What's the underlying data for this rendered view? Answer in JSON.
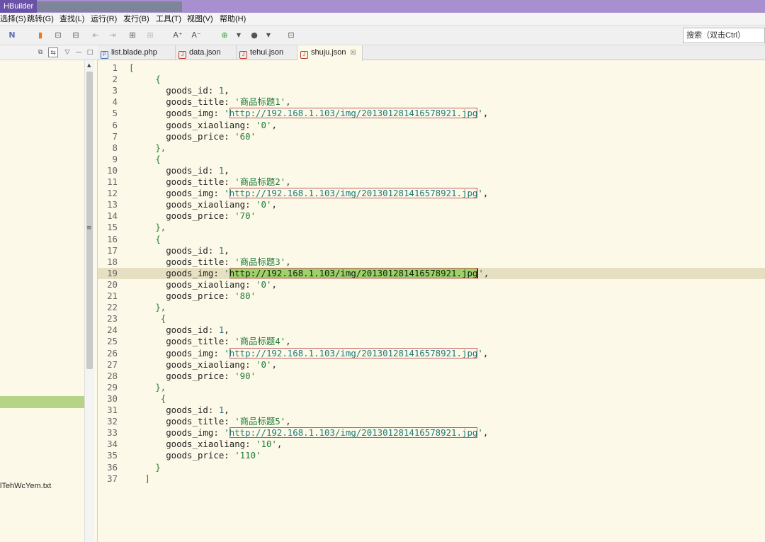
{
  "app": {
    "title": "HBuilder"
  },
  "menu": [
    "选择(S)",
    "跳转(G)",
    "查找(L)",
    "运行(R)",
    "发行(B)",
    "工具(T)",
    "视图(V)",
    "帮助(H)"
  ],
  "search": {
    "placeholder": "搜索（双击Ctrl）"
  },
  "sidebar": {
    "visible_file": "lTehWcYem.txt"
  },
  "tabs": [
    {
      "label": "list.blade.php",
      "icon": "php-file-icon"
    },
    {
      "label": "data.json",
      "icon": "json-file-icon"
    },
    {
      "label": "tehui.json",
      "icon": "json-file-icon"
    },
    {
      "label": "shuju.json",
      "icon": "json-file-icon",
      "active": true,
      "close": "☒"
    }
  ],
  "editor": {
    "current_line": 19,
    "lines": [
      {
        "n": "1",
        "parts": [
          [
            "p",
            "["
          ]
        ]
      },
      {
        "n": "2",
        "parts": [
          [
            "k",
            "     "
          ],
          [
            "p",
            "{"
          ]
        ]
      },
      {
        "n": "3",
        "parts": [
          [
            "k",
            "       goods_id: "
          ],
          [
            "n",
            "1"
          ],
          [
            "k",
            ","
          ]
        ]
      },
      {
        "n": "4",
        "parts": [
          [
            "k",
            "       goods_title: "
          ],
          [
            "s",
            "'商品标题1'"
          ],
          [
            "k",
            ","
          ]
        ]
      },
      {
        "n": "5",
        "parts": [
          [
            "k",
            "       goods_img: "
          ],
          [
            "s",
            "'"
          ],
          [
            "u",
            "http://192.168.1.103/img/201301281416578921.jpg"
          ],
          [
            "s",
            "'"
          ],
          [
            "k",
            ","
          ]
        ]
      },
      {
        "n": "6",
        "parts": [
          [
            "k",
            "       goods_xiaoliang: "
          ],
          [
            "s",
            "'0'"
          ],
          [
            "k",
            ","
          ]
        ]
      },
      {
        "n": "7",
        "parts": [
          [
            "k",
            "       goods_price: "
          ],
          [
            "s",
            "'60'"
          ]
        ]
      },
      {
        "n": "8",
        "parts": [
          [
            "k",
            "     "
          ],
          [
            "p",
            "},"
          ]
        ]
      },
      {
        "n": "9",
        "parts": [
          [
            "k",
            "     "
          ],
          [
            "p",
            "{"
          ]
        ]
      },
      {
        "n": "10",
        "parts": [
          [
            "k",
            "       goods_id: "
          ],
          [
            "n",
            "1"
          ],
          [
            "k",
            ","
          ]
        ]
      },
      {
        "n": "11",
        "parts": [
          [
            "k",
            "       goods_title: "
          ],
          [
            "s",
            "'商品标题2'"
          ],
          [
            "k",
            ","
          ]
        ]
      },
      {
        "n": "12",
        "parts": [
          [
            "k",
            "       goods_img: "
          ],
          [
            "s",
            "'"
          ],
          [
            "u",
            "http://192.168.1.103/img/201301281416578921.jpg"
          ],
          [
            "s",
            "'"
          ],
          [
            "k",
            ","
          ]
        ]
      },
      {
        "n": "13",
        "parts": [
          [
            "k",
            "       goods_xiaoliang: "
          ],
          [
            "s",
            "'0'"
          ],
          [
            "k",
            ","
          ]
        ]
      },
      {
        "n": "14",
        "parts": [
          [
            "k",
            "       goods_price: "
          ],
          [
            "s",
            "'70'"
          ]
        ]
      },
      {
        "n": "15",
        "parts": [
          [
            "k",
            "     "
          ],
          [
            "p",
            "},"
          ]
        ]
      },
      {
        "n": "16",
        "parts": [
          [
            "k",
            "     "
          ],
          [
            "p",
            "{"
          ]
        ]
      },
      {
        "n": "17",
        "parts": [
          [
            "k",
            "       goods_id: "
          ],
          [
            "n",
            "1"
          ],
          [
            "k",
            ","
          ]
        ]
      },
      {
        "n": "18",
        "parts": [
          [
            "k",
            "       goods_title: "
          ],
          [
            "s",
            "'商品标题3'"
          ],
          [
            "k",
            ","
          ]
        ]
      },
      {
        "n": "19",
        "parts": [
          [
            "k",
            "       goods_img: "
          ],
          [
            "s",
            "'"
          ],
          [
            "us",
            "http://192.168.1.103/img/201301281416578921.jpg"
          ],
          [
            "s",
            "'"
          ],
          [
            "k",
            ","
          ]
        ]
      },
      {
        "n": "20",
        "parts": [
          [
            "k",
            "       goods_xiaoliang: "
          ],
          [
            "s",
            "'0'"
          ],
          [
            "k",
            ","
          ]
        ]
      },
      {
        "n": "21",
        "parts": [
          [
            "k",
            "       goods_price: "
          ],
          [
            "s",
            "'80'"
          ]
        ]
      },
      {
        "n": "22",
        "parts": [
          [
            "k",
            "     "
          ],
          [
            "p",
            "},"
          ]
        ]
      },
      {
        "n": "23",
        "parts": [
          [
            "k",
            "      "
          ],
          [
            "p",
            "{"
          ]
        ]
      },
      {
        "n": "24",
        "parts": [
          [
            "k",
            "       goods_id: "
          ],
          [
            "n",
            "1"
          ],
          [
            "k",
            ","
          ]
        ]
      },
      {
        "n": "25",
        "parts": [
          [
            "k",
            "       goods_title: "
          ],
          [
            "s",
            "'商品标题4'"
          ],
          [
            "k",
            ","
          ]
        ]
      },
      {
        "n": "26",
        "parts": [
          [
            "k",
            "       goods_img: "
          ],
          [
            "s",
            "'"
          ],
          [
            "u",
            "http://192.168.1.103/img/201301281416578921.jpg"
          ],
          [
            "s",
            "'"
          ],
          [
            "k",
            ","
          ]
        ]
      },
      {
        "n": "27",
        "parts": [
          [
            "k",
            "       goods_xiaoliang: "
          ],
          [
            "s",
            "'0'"
          ],
          [
            "k",
            ","
          ]
        ]
      },
      {
        "n": "28",
        "parts": [
          [
            "k",
            "       goods_price: "
          ],
          [
            "s",
            "'90'"
          ]
        ]
      },
      {
        "n": "29",
        "parts": [
          [
            "k",
            "     "
          ],
          [
            "p",
            "},"
          ]
        ]
      },
      {
        "n": "30",
        "parts": [
          [
            "k",
            "      "
          ],
          [
            "p",
            "{"
          ]
        ]
      },
      {
        "n": "31",
        "parts": [
          [
            "k",
            "       goods_id: "
          ],
          [
            "n",
            "1"
          ],
          [
            "k",
            ","
          ]
        ]
      },
      {
        "n": "32",
        "parts": [
          [
            "k",
            "       goods_title: "
          ],
          [
            "s",
            "'商品标题5'"
          ],
          [
            "k",
            ","
          ]
        ]
      },
      {
        "n": "33",
        "parts": [
          [
            "k",
            "       goods_img: "
          ],
          [
            "s",
            "'"
          ],
          [
            "u",
            "http://192.168.1.103/img/201301281416578921.jpg"
          ],
          [
            "s",
            "'"
          ],
          [
            "k",
            ","
          ]
        ]
      },
      {
        "n": "34",
        "parts": [
          [
            "k",
            "       goods_xiaoliang: "
          ],
          [
            "s",
            "'10'"
          ],
          [
            "k",
            ","
          ]
        ]
      },
      {
        "n": "35",
        "parts": [
          [
            "k",
            "       goods_price: "
          ],
          [
            "s",
            "'110'"
          ]
        ]
      },
      {
        "n": "36",
        "parts": [
          [
            "k",
            "     "
          ],
          [
            "p",
            "}"
          ]
        ]
      },
      {
        "n": "37",
        "parts": [
          [
            "k",
            "   "
          ],
          [
            "p",
            "]"
          ]
        ]
      }
    ]
  }
}
